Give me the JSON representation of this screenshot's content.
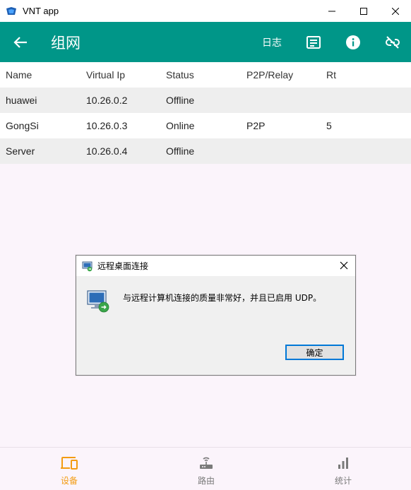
{
  "window": {
    "title": "VNT app",
    "controls": {
      "minimize": "—",
      "maximize": "☐",
      "close": "✕"
    }
  },
  "appbar": {
    "title": "组网",
    "log_label": "日志",
    "background": "#009688"
  },
  "table": {
    "columns": [
      "Name",
      "Virtual Ip",
      "Status",
      "P2P/Relay",
      "Rt"
    ],
    "rows": [
      [
        "huawei",
        "10.26.0.2",
        "Offline",
        "",
        ""
      ],
      [
        "GongSi",
        "10.26.0.3",
        "Online",
        "P2P",
        "5"
      ],
      [
        "Server",
        "10.26.0.4",
        "Offline",
        "",
        ""
      ]
    ]
  },
  "dialog": {
    "title": "远程桌面连接",
    "message": "与远程计算机连接的质量非常好，并且已启用 UDP。",
    "ok_label": "确定"
  },
  "bottomnav": {
    "items": [
      {
        "label": "设备",
        "icon": "devices-icon",
        "active": true
      },
      {
        "label": "路由",
        "icon": "router-icon",
        "active": false
      },
      {
        "label": "统计",
        "icon": "bar-chart-icon",
        "active": false
      }
    ],
    "active_color": "#f39c12",
    "inactive_color": "#7a7a7a"
  }
}
